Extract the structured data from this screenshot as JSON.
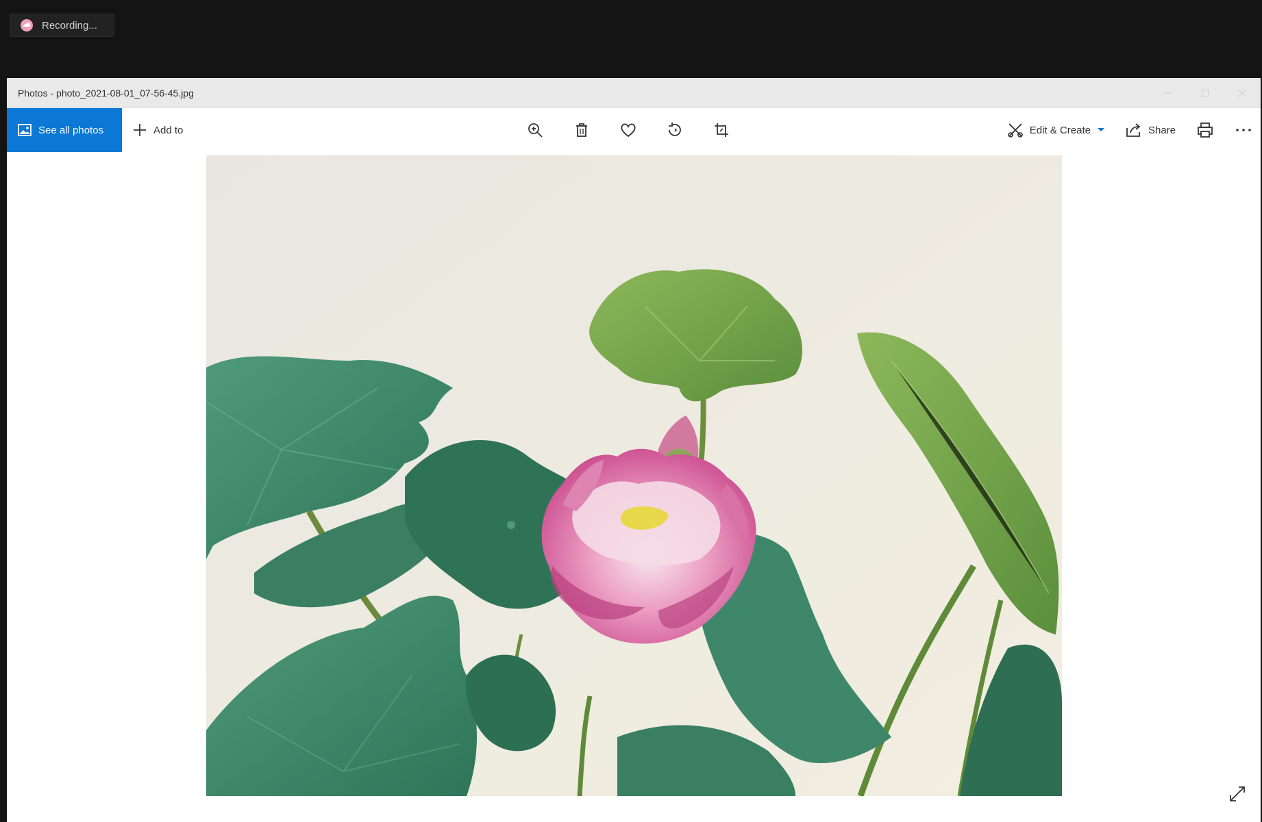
{
  "recording": {
    "label": "Recording...",
    "icon": "recording-cloud-icon"
  },
  "window": {
    "title": "Photos - photo_2021-08-01_07-56-45.jpg"
  },
  "toolbar": {
    "see_all_photos_label": "See all photos",
    "add_to_label": "Add to",
    "center_icons": [
      "zoom-icon",
      "delete-icon",
      "favorite-heart-icon",
      "rotate-icon",
      "crop-icon"
    ],
    "edit_create_label": "Edit & Create",
    "share_label": "Share",
    "print_icon": "print-icon",
    "more_icon": "more-options-icon"
  },
  "viewer": {
    "photo_subject": "lotus-photo",
    "expand_icon": "expand-diagonal-icon"
  },
  "colors": {
    "accent": "#0a78d4",
    "titlebar": "#e9e9e9",
    "desktop": "#141414"
  }
}
